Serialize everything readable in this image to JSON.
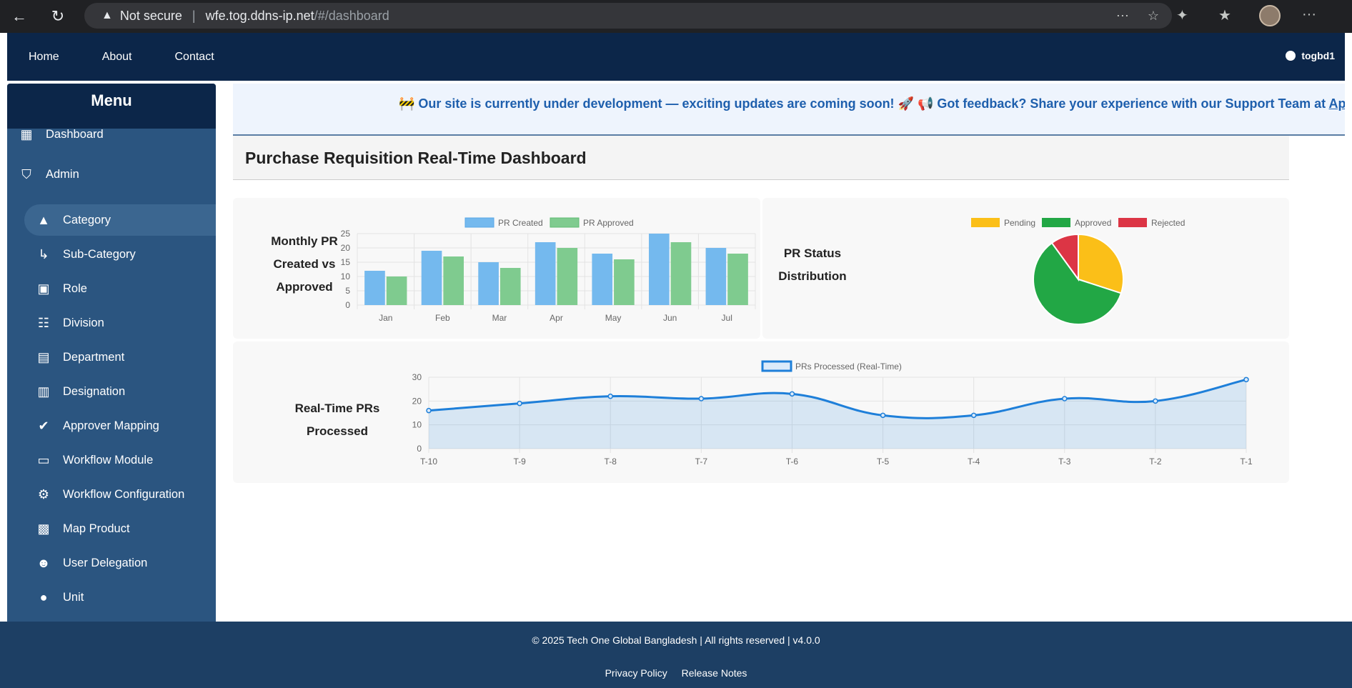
{
  "browser": {
    "security_text": "Not secure",
    "host": "wfe.tog.ddns-ip.net",
    "path": "/#/dashboard"
  },
  "topnav": {
    "links": [
      "Home",
      "About",
      "Contact"
    ],
    "username": "togbd1"
  },
  "sidebar": {
    "title": "Menu",
    "items": [
      {
        "label": "Dashboard",
        "icon": "dashboard-icon",
        "level": "top"
      },
      {
        "label": "Admin",
        "icon": "admin-icon",
        "level": "top"
      },
      {
        "label": "Category",
        "icon": "category-icon",
        "level": "sub",
        "active": true
      },
      {
        "label": "Sub-Category",
        "icon": "subdirectory-arrow-icon",
        "level": "sub"
      },
      {
        "label": "Role",
        "icon": "role-badge-icon",
        "level": "sub"
      },
      {
        "label": "Division",
        "icon": "hierarchy-icon",
        "level": "sub"
      },
      {
        "label": "Department",
        "icon": "building-icon",
        "level": "sub"
      },
      {
        "label": "Designation",
        "icon": "id-badge-icon",
        "level": "sub"
      },
      {
        "label": "Approver Mapping",
        "icon": "check-circle-icon",
        "level": "sub"
      },
      {
        "label": "Workflow Module",
        "icon": "briefcase-icon",
        "level": "sub"
      },
      {
        "label": "Workflow Configuration",
        "icon": "gear-icon",
        "level": "sub"
      },
      {
        "label": "Map Product",
        "icon": "map-icon",
        "level": "sub"
      },
      {
        "label": "User Delegation",
        "icon": "users-icon",
        "level": "sub"
      },
      {
        "label": "Unit",
        "icon": "unit-icon",
        "level": "sub"
      }
    ]
  },
  "banner": {
    "text": "🚧 Our site is currently under development — exciting updates are coming soon! 🚀 📢 Got feedback? Share your experience with our Support Team at ",
    "link_text": "Appli"
  },
  "page_title": "Purchase Requisition Real-Time Dashboard",
  "cards": {
    "monthly_label": [
      "Monthly PR",
      "Created vs",
      "Approved"
    ],
    "status_label": [
      "PR Status",
      "Distribution"
    ],
    "realtime_label": "Real-Time PRs Processed"
  },
  "colors": {
    "pr_created": "#74b9ee",
    "pr_approved": "#7fcb8f",
    "pending": "#fbbf18",
    "approved": "#22a745",
    "rejected": "#dc3545",
    "line": "#1e7fd9"
  },
  "chart_data": [
    {
      "type": "bar",
      "categories": [
        "Jan",
        "Feb",
        "Mar",
        "Apr",
        "May",
        "Jun",
        "Jul"
      ],
      "series": [
        {
          "name": "PR Created",
          "values": [
            12,
            19,
            15,
            22,
            18,
            25,
            20
          ]
        },
        {
          "name": "PR Approved",
          "values": [
            10,
            17,
            13,
            20,
            16,
            22,
            18
          ]
        }
      ],
      "yticks": [
        "0",
        "5",
        "10",
        "15",
        "20",
        "25"
      ],
      "ylim": [
        0,
        25
      ],
      "legend": "top",
      "grid": true
    },
    {
      "type": "pie",
      "categories": [
        "Pending",
        "Approved",
        "Rejected"
      ],
      "values": [
        30,
        60,
        10
      ],
      "legend": "top"
    },
    {
      "type": "area",
      "categories": [
        "T-10",
        "T-9",
        "T-8",
        "T-7",
        "T-6",
        "T-5",
        "T-4",
        "T-3",
        "T-2",
        "T-1"
      ],
      "series": [
        {
          "name": "PRs Processed (Real-Time)",
          "values": [
            16,
            19,
            22,
            21,
            23,
            14,
            14,
            21,
            20,
            29
          ]
        }
      ],
      "yticks": [
        "0",
        "10",
        "20",
        "30"
      ],
      "ylim": [
        0,
        30
      ],
      "legend": "top",
      "grid": true
    }
  ],
  "footer": {
    "copyright": "© 2025 Tech One Global Bangladesh | All rights reserved | v4.0.0",
    "links": [
      "Privacy Policy",
      "Release Notes"
    ]
  }
}
